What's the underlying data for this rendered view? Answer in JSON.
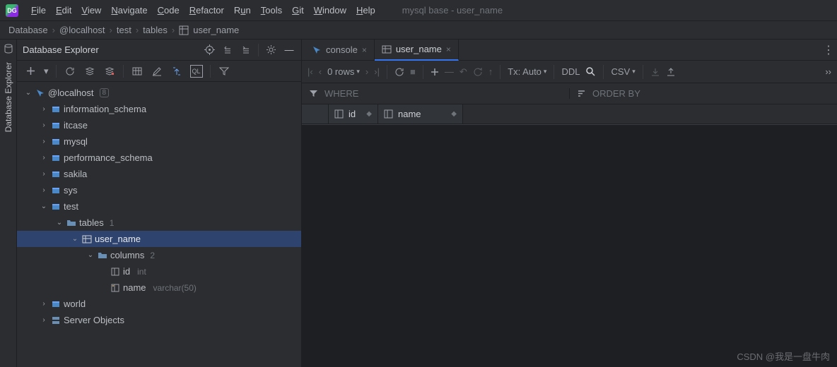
{
  "menu": {
    "file": "File",
    "edit": "Edit",
    "view": "View",
    "navigate": "Navigate",
    "code": "Code",
    "refactor": "Refactor",
    "run": "Run",
    "tools": "Tools",
    "git": "Git",
    "window": "Window",
    "help": "Help"
  },
  "window_title": "mysql base - user_name",
  "breadcrumb": {
    "b1": "Database",
    "b2": "@localhost",
    "b3": "test",
    "b4": "tables",
    "b5": "user_name"
  },
  "side_tool": "Database Explorer",
  "explorer": {
    "title": "Database Explorer",
    "host": "@localhost",
    "host_badge": "8",
    "db_info": "information_schema",
    "db_itcase": "itcase",
    "db_mysql": "mysql",
    "db_perf": "performance_schema",
    "db_sakila": "sakila",
    "db_sys": "sys",
    "db_test": "test",
    "tables": "tables",
    "tables_badge": "1",
    "tbl_user": "user_name",
    "columns": "columns",
    "columns_badge": "2",
    "col_id": "id",
    "col_id_type": "int",
    "col_name": "name",
    "col_name_type": "varchar(50)",
    "db_world": "world",
    "server_objects": "Server Objects"
  },
  "tabs": {
    "console": "console",
    "user_name": "user_name"
  },
  "toolbar": {
    "rows": "0 rows",
    "tx": "Tx: Auto",
    "ddl": "DDL",
    "csv": "CSV"
  },
  "filters": {
    "where": "WHERE",
    "order": "ORDER BY"
  },
  "columns": {
    "id": "id",
    "name": "name"
  },
  "watermark": "CSDN @我是一盘牛肉"
}
